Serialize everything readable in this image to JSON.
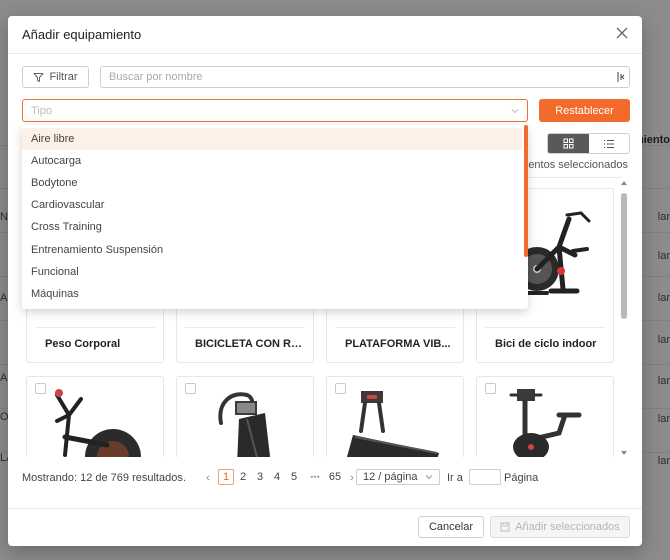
{
  "modal": {
    "title": "Añadir equipamiento"
  },
  "toolbar": {
    "filter_label": "Filtrar",
    "search_placeholder": "Buscar por nombre",
    "type_placeholder": "Tipo",
    "reset_label": "Restablecer"
  },
  "selection_info": "mentos seleccionados",
  "dropdown": {
    "items": [
      "Aire libre",
      "Autocarga",
      "Bodytone",
      "Cardiovascular",
      "Cross Training",
      "Entrenamiento Suspensión",
      "Funcional",
      "Máquinas"
    ],
    "active_index": 0
  },
  "cards_row1": [
    {
      "name": "Peso Corporal"
    },
    {
      "name": "BICICLETA CON RE..."
    },
    {
      "name": "PLATAFORMA VIB..."
    },
    {
      "name": "Bici de ciclo indoor"
    }
  ],
  "pagination": {
    "total_text": "Mostrando: 12 de 769 resultados.",
    "prev_icon": "‹",
    "next_icon": "›",
    "pages": [
      "1",
      "2",
      "3",
      "4",
      "5"
    ],
    "ellipsis": "•••",
    "last_page": "65",
    "current_page": "1",
    "page_size": "12 / página",
    "goto_label": "Ir a",
    "page_label": "Página"
  },
  "footer": {
    "cancel_label": "Cancelar",
    "add_label": "Añadir seleccionados"
  },
  "background": {
    "right_header": "ipamiento",
    "right_cells": [
      "lar",
      "lar",
      "lar",
      "lar",
      "lar",
      "lar",
      "lar",
      "lar",
      "lar",
      "lar"
    ],
    "left_chars": [
      "N",
      "A",
      "A",
      "O",
      "LA"
    ]
  },
  "colors": {
    "accent": "#f26a2c",
    "toggle_active": "#595959"
  }
}
